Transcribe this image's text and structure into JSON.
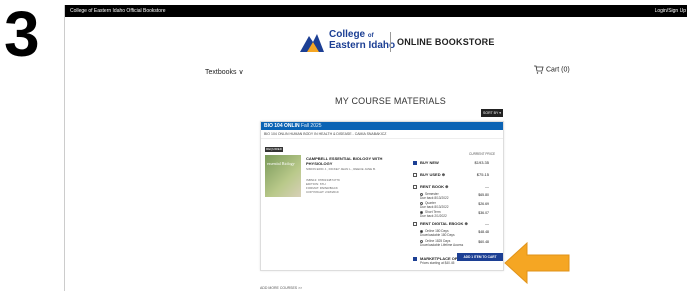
{
  "step_number": "3",
  "topbar": {
    "left": "College of Eastern Idaho Official Bookstore",
    "right": "Login/Sign Up"
  },
  "logo": {
    "line1": "College",
    "line1b": "of",
    "line2": "Eastern Idaho",
    "store": "ONLINE BOOKSTORE"
  },
  "nav": {
    "textbooks": "Textbooks ∨",
    "cart": "Cart (0)"
  },
  "page_title": "MY COURSE MATERIALS",
  "sort_by": "SORT BY ▾",
  "course": {
    "code": "BIO 104 ONLIN",
    "term": "Fall 2025",
    "subtitle": "BIO 104 ONLIN HUMAN BODY IN HEALTH & DISEASE - CAMIA SNABAKICZ",
    "required": "REQUIRED",
    "cover_text": "essential Biology",
    "book_title": "CAMPBELL ESSENTIAL BIOLOGY WITH PHYSIOLOGY",
    "authors": "SIMON ERIC J., DICKEY JEAN L., REECE JANE B.",
    "isbn": "ISBN13: 9780134874779",
    "edition": "EDITION: 6TH",
    "format": "FORMAT: PAPERBACK",
    "copyright": "COPYRIGHT: 2/18/2019",
    "current_price_label": "CURRENT PRICE",
    "options": [
      {
        "label": "BUY NEW",
        "price": "$193.35",
        "checked": true
      },
      {
        "label": "BUY USED ⊕",
        "price": "$75.15",
        "checked": false
      },
      {
        "label": "RENT BOOK ⊕",
        "price": "—",
        "checked": false
      },
      {
        "label": "RENT DIGITAL EBOOK ⊕",
        "price": "—",
        "checked": false
      },
      {
        "label": "MARKETPLACE OPTIONS ⊕",
        "price": "",
        "checked": true
      }
    ],
    "rent_sub": [
      {
        "label": "Semester",
        "due": "Due back 8/13/2022",
        "price": "$65.80",
        "selected": false
      },
      {
        "label": "Quarter",
        "due": "Due back 8/13/2022",
        "price": "$26.69",
        "selected": false
      },
      {
        "label": "Short Term",
        "due": "Due back 2/1/2022",
        "price": "$36.07",
        "selected": true
      }
    ],
    "ebook_sub": [
      {
        "label": "Online 180 Days Downloadable 180 Days",
        "price": "$48.48",
        "selected": true
      },
      {
        "label": "Online 1825 Days Downloadable Lifetime Access",
        "price": "$60.48",
        "selected": false
      }
    ],
    "marketplace_note": "Prices starting at $40.45",
    "add_button": "ADD 1 ITEM TO CART"
  },
  "add_more": "ADD MORE COURSES >>",
  "colors": {
    "brand_blue": "#1c3f94",
    "course_bar": "#0b63b4",
    "arrow": "#f5a623"
  }
}
